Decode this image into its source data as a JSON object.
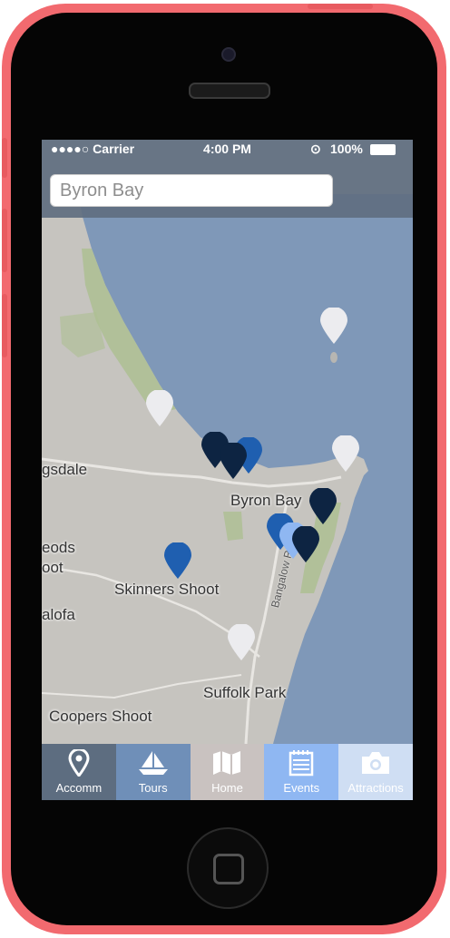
{
  "status": {
    "carrier": "●●●●○ Carrier",
    "time": "4:00 PM",
    "battery": "100%"
  },
  "search": {
    "value": "Byron Bay"
  },
  "map": {
    "labels": {
      "byron_bay": "Byron Bay",
      "skinners_shoot": "Skinners Shoot",
      "suffolk_park": "Suffolk Park",
      "coopers_shoot": "Coopers Shoot",
      "ewingsdale": "gsdale",
      "mcleods": "eods",
      "mcleods2": "oot",
      "talofa": "alofa",
      "bangalow_rd": "Bangalow R"
    }
  },
  "tabs": [
    {
      "label": "Accomm",
      "color": "#5d6d80",
      "icon": "location-pin-icon"
    },
    {
      "label": "Tours",
      "color": "#6f8fb8",
      "icon": "sailboat-icon"
    },
    {
      "label": "Home",
      "color": "#c9c2c0",
      "icon": "map-icon"
    },
    {
      "label": "Events",
      "color": "#8fb7f2",
      "icon": "calendar-icon"
    },
    {
      "label": "Attractions",
      "color": "#cfdef3",
      "icon": "camera-icon"
    }
  ]
}
